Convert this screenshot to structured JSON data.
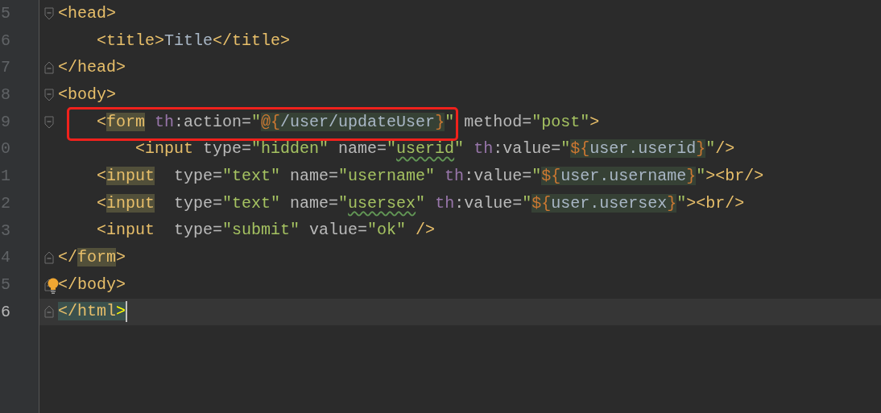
{
  "editor": {
    "lines": [
      {
        "number": "5",
        "kind": "start",
        "current": false,
        "annotated": false,
        "bulb": false,
        "caret": false,
        "tokens": [
          {
            "text": "<head>",
            "kind": "tag"
          }
        ]
      },
      {
        "number": "6",
        "kind": "plain",
        "current": false,
        "annotated": false,
        "bulb": false,
        "caret": false,
        "tokens": [
          {
            "text": "    <title>",
            "kind": "tag"
          },
          {
            "text": "Title",
            "kind": "text"
          },
          {
            "text": "</title>",
            "kind": "tag"
          }
        ]
      },
      {
        "number": "7",
        "kind": "end",
        "current": false,
        "annotated": false,
        "bulb": false,
        "caret": false,
        "tokens": [
          {
            "text": "</head>",
            "kind": "tag"
          }
        ]
      },
      {
        "number": "8",
        "kind": "start",
        "current": false,
        "annotated": false,
        "bulb": false,
        "caret": false,
        "tokens": [
          {
            "text": "<body>",
            "kind": "tag"
          }
        ]
      },
      {
        "number": "9",
        "kind": "start",
        "current": false,
        "annotated": true,
        "bulb": false,
        "caret": false,
        "tokens": [
          {
            "text": "    <",
            "kind": "tag"
          },
          {
            "text": "form",
            "kind": "tag",
            "matched": true
          },
          {
            "text": " th",
            "kind": "ns"
          },
          {
            "text": ":action=",
            "kind": "attr"
          },
          {
            "text": "\"",
            "kind": "string"
          },
          {
            "text": "@{",
            "kind": "brace",
            "injected": true
          },
          {
            "text": "/user/updateUser",
            "kind": "text",
            "injected": true
          },
          {
            "text": "}",
            "kind": "brace",
            "injected": true
          },
          {
            "text": "\"",
            "kind": "string"
          },
          {
            "text": " method=",
            "kind": "attr"
          },
          {
            "text": "\"post\"",
            "kind": "string"
          },
          {
            "text": ">",
            "kind": "tag"
          }
        ]
      },
      {
        "number": "0",
        "kind": "plain",
        "current": false,
        "annotated": false,
        "bulb": false,
        "caret": false,
        "tokens": [
          {
            "text": "        <input",
            "kind": "tag"
          },
          {
            "text": " type=",
            "kind": "attr"
          },
          {
            "text": "\"hidden\"",
            "kind": "string"
          },
          {
            "text": " name=",
            "kind": "attr"
          },
          {
            "text": "\"",
            "kind": "string"
          },
          {
            "text": "userid",
            "kind": "string",
            "typo": true
          },
          {
            "text": "\"",
            "kind": "string"
          },
          {
            "text": " th",
            "kind": "ns"
          },
          {
            "text": ":value=",
            "kind": "attr"
          },
          {
            "text": "\"",
            "kind": "string"
          },
          {
            "text": "${",
            "kind": "brace",
            "injected": true
          },
          {
            "text": "user.userid",
            "kind": "text",
            "injected": true
          },
          {
            "text": "}",
            "kind": "brace",
            "injected": true
          },
          {
            "text": "\"",
            "kind": "string"
          },
          {
            "text": "/>",
            "kind": "tag"
          }
        ]
      },
      {
        "number": "1",
        "kind": "plain",
        "current": false,
        "annotated": false,
        "bulb": false,
        "caret": false,
        "tokens": [
          {
            "text": "    <",
            "kind": "tag"
          },
          {
            "text": "input",
            "kind": "tag",
            "matched": true
          },
          {
            "text": "  type=",
            "kind": "attr"
          },
          {
            "text": "\"text\"",
            "kind": "string"
          },
          {
            "text": " name=",
            "kind": "attr"
          },
          {
            "text": "\"username\"",
            "kind": "string"
          },
          {
            "text": " th",
            "kind": "ns"
          },
          {
            "text": ":value=",
            "kind": "attr"
          },
          {
            "text": "\"",
            "kind": "string"
          },
          {
            "text": "${",
            "kind": "brace",
            "injected": true
          },
          {
            "text": "user.username",
            "kind": "text",
            "injected": true
          },
          {
            "text": "}",
            "kind": "brace",
            "injected": true
          },
          {
            "text": "\"",
            "kind": "string"
          },
          {
            "text": "><br/>",
            "kind": "tag"
          }
        ]
      },
      {
        "number": "2",
        "kind": "plain",
        "current": false,
        "annotated": false,
        "bulb": false,
        "caret": false,
        "tokens": [
          {
            "text": "    <",
            "kind": "tag"
          },
          {
            "text": "input",
            "kind": "tag",
            "matched": true
          },
          {
            "text": "  type=",
            "kind": "attr"
          },
          {
            "text": "\"text\"",
            "kind": "string"
          },
          {
            "text": " name=",
            "kind": "attr"
          },
          {
            "text": "\"",
            "kind": "string"
          },
          {
            "text": "usersex",
            "kind": "string",
            "typo": true
          },
          {
            "text": "\"",
            "kind": "string"
          },
          {
            "text": " th",
            "kind": "ns"
          },
          {
            "text": ":value=",
            "kind": "attr"
          },
          {
            "text": "\"",
            "kind": "string"
          },
          {
            "text": "${",
            "kind": "brace",
            "injected": true
          },
          {
            "text": "user.usersex",
            "kind": "text",
            "injected": true
          },
          {
            "text": "}",
            "kind": "brace",
            "injected": true
          },
          {
            "text": "\"",
            "kind": "string"
          },
          {
            "text": "><br/>",
            "kind": "tag"
          }
        ]
      },
      {
        "number": "3",
        "kind": "plain",
        "current": false,
        "annotated": false,
        "bulb": false,
        "caret": false,
        "tokens": [
          {
            "text": "    <input",
            "kind": "tag"
          },
          {
            "text": "  type=",
            "kind": "attr"
          },
          {
            "text": "\"submit\"",
            "kind": "string"
          },
          {
            "text": " value=",
            "kind": "attr"
          },
          {
            "text": "\"ok\"",
            "kind": "string"
          },
          {
            "text": " />",
            "kind": "tag"
          }
        ]
      },
      {
        "number": "4",
        "kind": "end",
        "current": false,
        "annotated": false,
        "bulb": false,
        "caret": false,
        "tokens": [
          {
            "text": "</",
            "kind": "tag"
          },
          {
            "text": "form",
            "kind": "tag",
            "matched": true
          },
          {
            "text": ">",
            "kind": "tag"
          }
        ]
      },
      {
        "number": "5",
        "kind": "end",
        "current": false,
        "annotated": false,
        "bulb": true,
        "caret": false,
        "tokens": [
          {
            "text": "</body>",
            "kind": "tag"
          }
        ]
      },
      {
        "number": "6",
        "kind": "end",
        "current": true,
        "annotated": false,
        "bulb": false,
        "caret": true,
        "tokens": [
          {
            "text": "</html",
            "kind": "tag",
            "paired": true
          },
          {
            "text": ">",
            "kind": "bright",
            "paired": true
          }
        ]
      }
    ]
  }
}
